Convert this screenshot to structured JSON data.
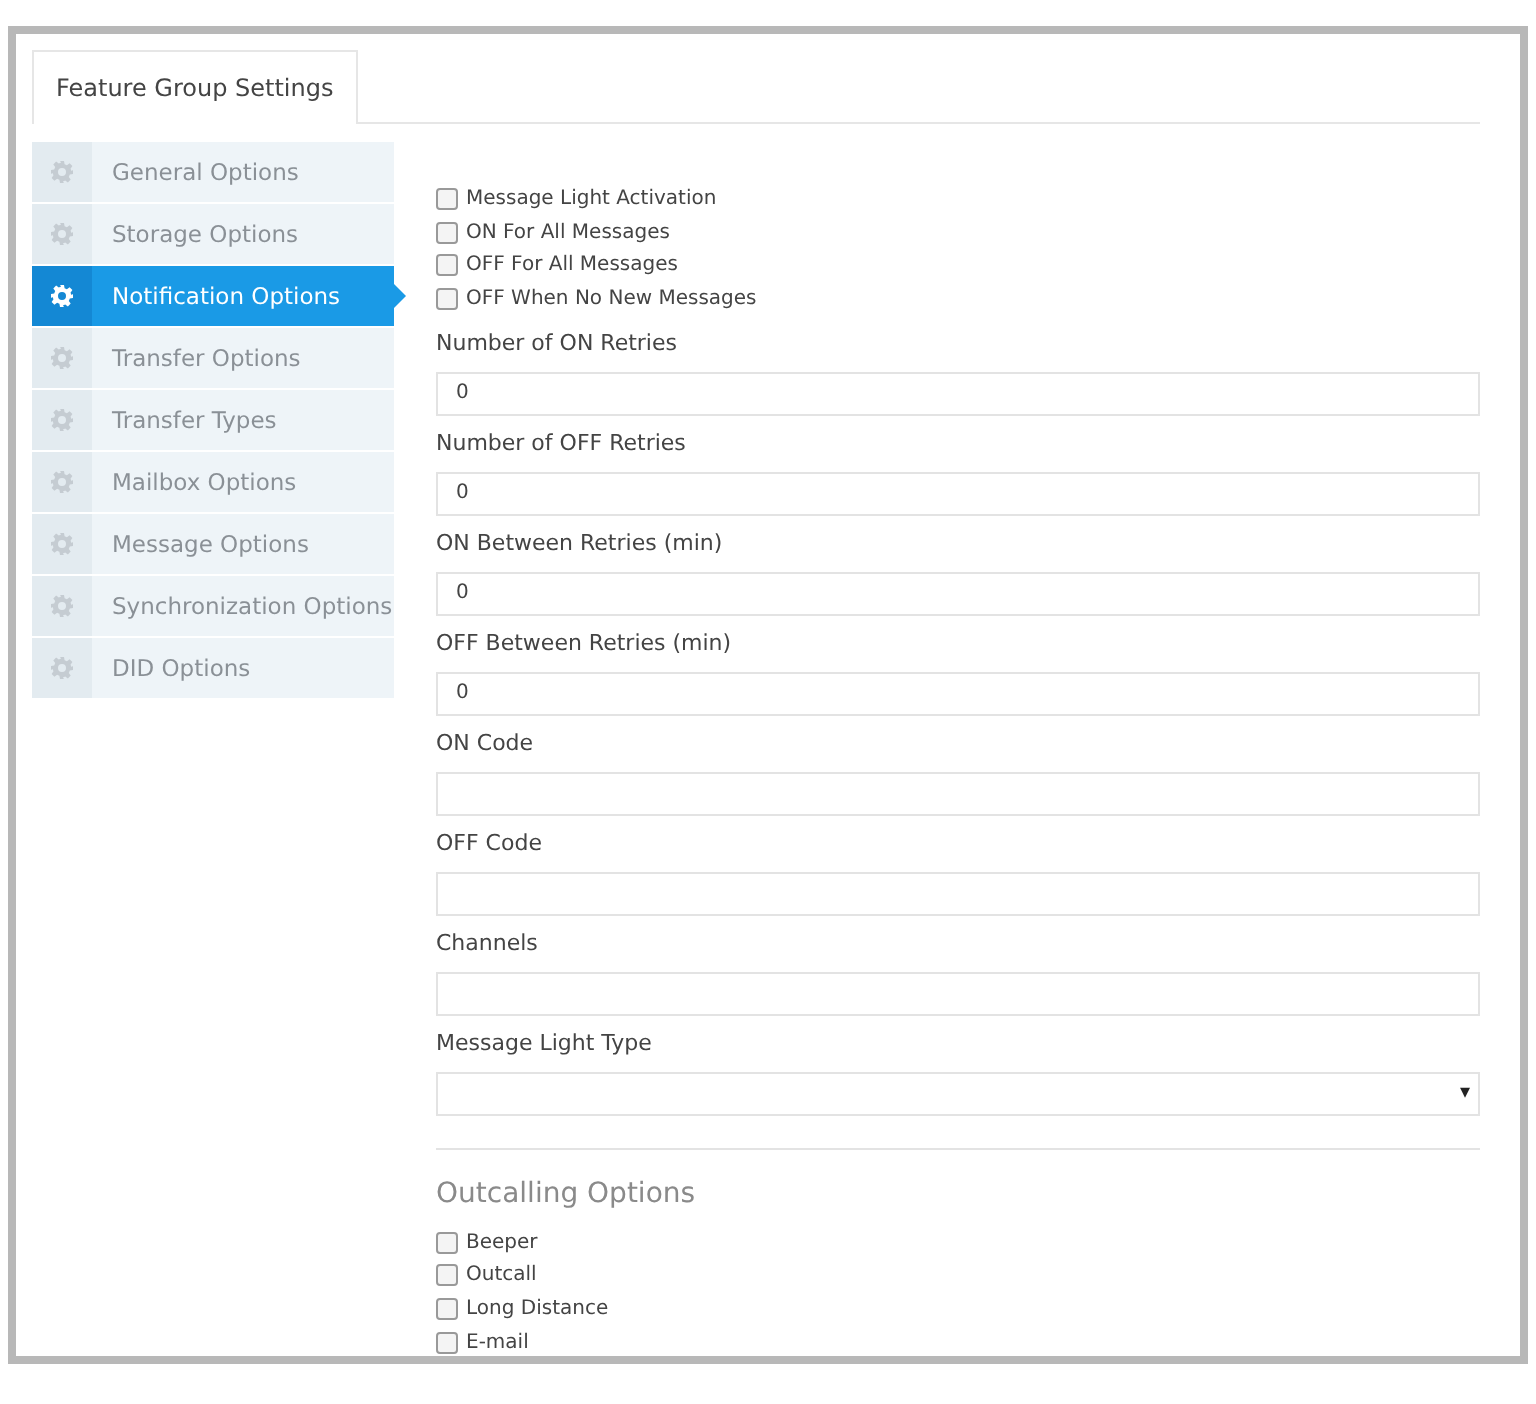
{
  "tabs": [
    {
      "label": "Feature Group Settings",
      "selected": true
    }
  ],
  "sidebar": {
    "items": [
      {
        "label": "General Options",
        "selected": false
      },
      {
        "label": "Storage Options",
        "selected": false
      },
      {
        "label": "Notification Options",
        "selected": true
      },
      {
        "label": "Transfer Options",
        "selected": false
      },
      {
        "label": "Transfer Types",
        "selected": false
      },
      {
        "label": "Mailbox Options",
        "selected": false
      },
      {
        "label": "Message Options",
        "selected": false
      },
      {
        "label": "Synchronization Options",
        "selected": false
      },
      {
        "label": "DID Options",
        "selected": false
      }
    ]
  },
  "message_light_checkboxes": [
    {
      "label": "Message Light Activation",
      "checked": false
    },
    {
      "label": "ON For All Messages",
      "checked": false
    },
    {
      "label": "OFF For All Messages",
      "checked": false
    },
    {
      "label": "OFF When No New Messages",
      "checked": false
    }
  ],
  "fields": [
    {
      "kind": "input",
      "label": "Number of ON Retries",
      "value": "0"
    },
    {
      "kind": "input",
      "label": "Number of OFF Retries",
      "value": "0"
    },
    {
      "kind": "input",
      "label": "ON Between Retries (min)",
      "value": "0"
    },
    {
      "kind": "input",
      "label": "OFF Between Retries (min)",
      "value": "0"
    },
    {
      "kind": "input",
      "label": "ON Code"
    },
    {
      "kind": "input",
      "label": "OFF Code"
    },
    {
      "kind": "input",
      "label": "Channels"
    },
    {
      "kind": "select",
      "label": "Message Light Type",
      "arrow": "▾"
    }
  ],
  "outcalling": {
    "title": "Outcalling Options",
    "checkboxes": [
      {
        "label": "Beeper",
        "checked": false
      },
      {
        "label": "Outcall",
        "checked": false
      },
      {
        "label": "Long Distance",
        "checked": false
      },
      {
        "label": "E-mail",
        "checked": false
      }
    ]
  }
}
